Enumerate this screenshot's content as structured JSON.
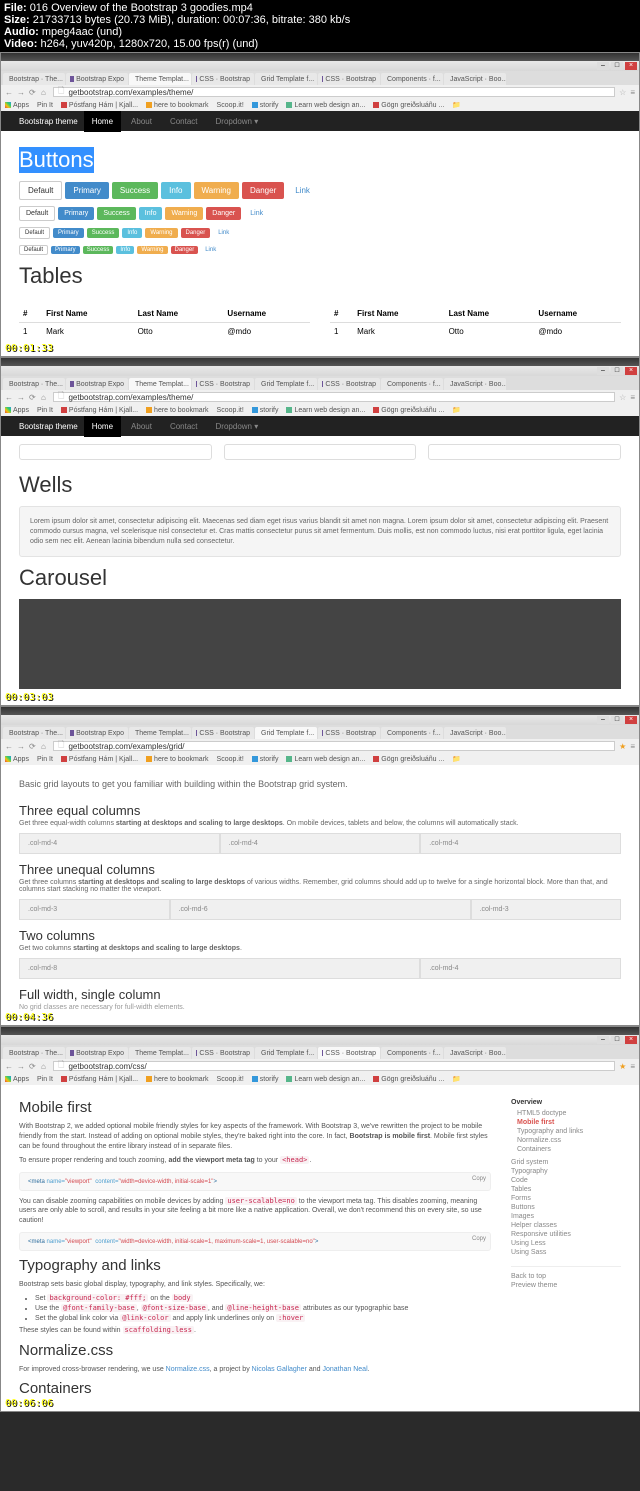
{
  "file_info": {
    "file_label": "File:",
    "file_name": "016 Overview of the Bootstrap 3 goodies.mp4",
    "size_label": "Size:",
    "size_bytes": "21733713 bytes (20.73 MiB)",
    "duration_label": "duration:",
    "duration": "00:07:36",
    "bitrate_label": "bitrate:",
    "bitrate": "380 kb/s",
    "audio_label": "Audio:",
    "audio": "mpeg4aac (und)",
    "video_label": "Video:",
    "video": "h264, yuv420p, 1280x720, 15.00 fps(r) (und)"
  },
  "timestamps": [
    "00:01:33",
    "00:03:03",
    "00:04:36",
    "00:06:06"
  ],
  "tabs": [
    {
      "label": "Bootstrap · The...",
      "active": false
    },
    {
      "label": "Bootstrap Expo",
      "active": false
    },
    {
      "label": "Theme Templat...",
      "active": true
    },
    {
      "label": "CSS · Bootstrap",
      "active": false
    },
    {
      "label": "Grid Template f...",
      "active": false
    },
    {
      "label": "CSS · Bootstrap",
      "active": false
    },
    {
      "label": "Components · f...",
      "active": false
    },
    {
      "label": "JavaScript · Boo...",
      "active": false
    }
  ],
  "tabs_f3": [
    {
      "label": "Bootstrap · The...",
      "active": false
    },
    {
      "label": "Bootstrap Expo",
      "active": false
    },
    {
      "label": "Theme Templat...",
      "active": false
    },
    {
      "label": "CSS · Bootstrap",
      "active": false
    },
    {
      "label": "Grid Template f...",
      "active": true
    },
    {
      "label": "CSS · Bootstrap",
      "active": false
    },
    {
      "label": "Components · f...",
      "active": false
    },
    {
      "label": "JavaScript · Boo...",
      "active": false
    }
  ],
  "tabs_f4": [
    {
      "label": "Bootstrap · The...",
      "active": false
    },
    {
      "label": "Bootstrap Expo",
      "active": false
    },
    {
      "label": "Theme Templat...",
      "active": false
    },
    {
      "label": "CSS · Bootstrap",
      "active": false
    },
    {
      "label": "Grid Template f...",
      "active": false
    },
    {
      "label": "CSS · Bootstrap",
      "active": true
    },
    {
      "label": "Components · f...",
      "active": false
    },
    {
      "label": "JavaScript · Boo...",
      "active": false
    }
  ],
  "urls": {
    "f1": "getbootstrap.com/examples/theme/",
    "f3": "getbootstrap.com/examples/grid/",
    "f4": "getbootstrap.com/css/"
  },
  "bookmarks": {
    "apps": "Apps",
    "pinit": "Pin It",
    "postfang": "Póstfang Hám | Kjall...",
    "here": "here to bookmark",
    "scoop": "Scoop.it!",
    "storify": "storify",
    "learn": "Learn web design an...",
    "gogn": "Gögn greiðsluáñu ...",
    "file": "file"
  },
  "navbar": {
    "brand": "Bootstrap theme",
    "home": "Home",
    "about": "About",
    "contact": "Contact",
    "dropdown": "Dropdown ▾"
  },
  "frame1": {
    "heading_buttons": "Buttons",
    "btns": {
      "default": "Default",
      "primary": "Primary",
      "success": "Success",
      "info": "Info",
      "warning": "Warning",
      "danger": "Danger",
      "link": "Link"
    },
    "heading_tables": "Tables",
    "table_headers": [
      "#",
      "First Name",
      "Last Name",
      "Username"
    ],
    "table_row": [
      "1",
      "Mark",
      "Otto",
      "@mdo"
    ]
  },
  "frame2": {
    "heading_wells": "Wells",
    "well_text": "Lorem ipsum dolor sit amet, consectetur adipiscing elit. Maecenas sed diam eget risus varius blandit sit amet non magna. Lorem ipsum dolor sit amet, consectetur adipiscing elit. Praesent commodo cursus magna, vel scelerisque nisl consectetur et. Cras mattis consectetur purus sit amet fermentum. Duis mollis, est non commodo luctus, nisi erat porttitor ligula, eget lacinia odio sem nec elit. Aenean lacinia bibendum nulla sed consectetur.",
    "heading_carousel": "Carousel"
  },
  "frame3": {
    "intro": "Basic grid layouts to get you familiar with building within the Bootstrap grid system.",
    "sec1_h": "Three equal columns",
    "sec1_p1": "Get three equal-width columns ",
    "sec1_bold": "starting at desktops and scaling to large desktops",
    "sec1_p2": ". On mobile devices, tablets and below, the columns will automatically stack.",
    "col_md_4": ".col-md-4",
    "sec2_h": "Three unequal columns",
    "sec2_p1": "Get three columns ",
    "sec2_p2": " of various widths. Remember, grid columns should add up to twelve for a single horizontal block. More than that, and columns start stacking no matter the viewport.",
    "col_md_3": ".col-md-3",
    "col_md_6": ".col-md-6",
    "sec3_h": "Two columns",
    "sec3_p": "Get two columns ",
    "col_md_8": ".col-md-8",
    "sec4_h": "Full width, single column",
    "sec4_p": "No grid classes are necessary for full-width elements."
  },
  "frame4": {
    "h_mobile": "Mobile first",
    "p1": "With Bootstrap 2, we added optional mobile friendly styles for key aspects of the framework. With Bootstrap 3, we've rewritten the project to be mobile friendly from the start. Instead of adding on optional mobile styles, they're baked right into the core. In fact, ",
    "p1_bold": "Bootstrap is mobile first",
    "p1_after": ". Mobile first styles can be found throughout the entire library instead of in separate files.",
    "p2": "To ensure proper rendering and touch zooming, ",
    "p2_bold": "add the viewport meta tag",
    "p2_after": " to your ",
    "code_head": "<head>",
    "copy": "Copy",
    "code1_pre": "<meta ",
    "code1_name": "name=",
    "code1_name_v": "\"viewport\"",
    "code1_content": "content=",
    "code1_content_v": "\"width=device-width, initial-scale=1\"",
    "code1_end": ">",
    "p3a": "You can disable zooming capabilities on mobile devices by adding ",
    "code_us": "user-scalable=no",
    "p3b": " to the viewport meta tag. This disables zooming, meaning users are only able to scroll, and results in your site feeling a bit more like a native application. Overall, we don't recommend this on every site, so use caution!",
    "code2_content_v": "\"width=device-width, initial-scale=1, maximum-scale=1, user-scalable=no\"",
    "h_typo": "Typography and links",
    "p4": "Bootstrap sets basic global display, typography, and link styles. Specifically, we:",
    "li1a": "Set ",
    "li1_c1": "background-color: #fff;",
    "li1b": " on the ",
    "li1_c2": "body",
    "li2a": "Use the ",
    "li2_c1": "@font-family-base",
    "li2b": ", ",
    "li2_c2": "@font-size-base",
    "li2c": ", and ",
    "li2_c3": "@line-height-base",
    "li2d": " attributes as our typographic base",
    "li3a": "Set the global link color via ",
    "li3_c1": "@link-color",
    "li3b": " and apply link underlines only on ",
    "li3_c2": ":hover",
    "p5a": "These styles can be found within ",
    "p5_c": "scaffolding.less",
    "h_norm": "Normalize.css",
    "p6a": "For improved cross-browser rendering, we use ",
    "p6_l1": "Normalize.css",
    "p6b": ", a project by ",
    "p6_l2": "Nicolas Gallagher",
    "p6c": " and ",
    "p6_l3": "Jonathan Neal",
    "p6d": ".",
    "h_cont": "Containers",
    "sidebar": {
      "overview": "Overview",
      "items1": [
        "HTML5 doctype",
        "Mobile first",
        "Typography and links",
        "Normalize.css",
        "Containers"
      ],
      "items2": [
        "Grid system",
        "Typography",
        "Code",
        "Tables",
        "Forms",
        "Buttons",
        "Images",
        "Helper classes",
        "Responsive utilities",
        "Using Less",
        "Using Sass"
      ],
      "back": "Back to top",
      "preview": "Preview theme"
    }
  }
}
